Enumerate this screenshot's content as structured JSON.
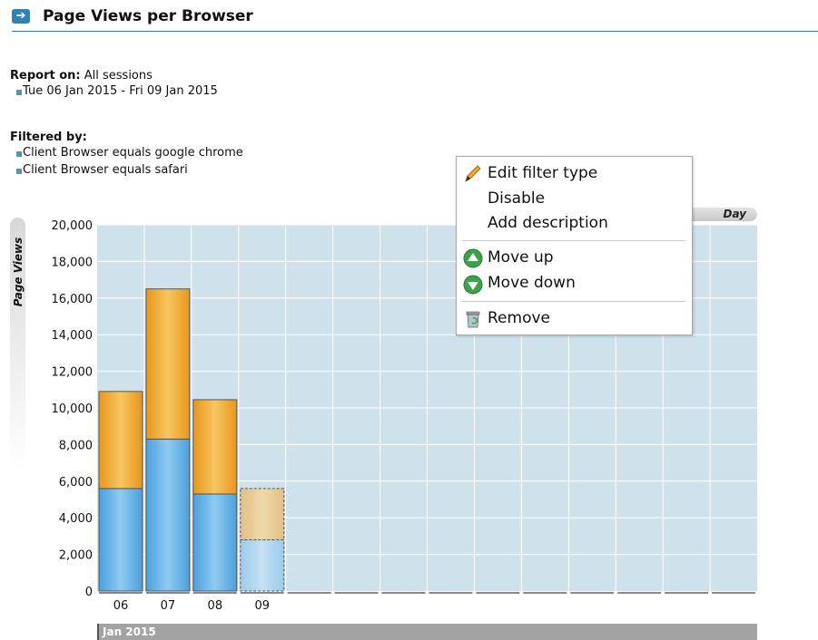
{
  "report": {
    "title": "Page Views per Browser",
    "report_on_label": "Report on:",
    "report_on_value": "All sessions",
    "date_range": "Tue 06 Jan 2015 - Fri 09 Jan 2015",
    "filtered_by_label": "Filtered by:",
    "filters": [
      "Client Browser equals google chrome",
      "Client Browser equals safari"
    ]
  },
  "context_menu": {
    "edit_filter_type": "Edit filter type",
    "disable": "Disable",
    "add_description": "Add description",
    "move_up": "Move up",
    "move_down": "Move down",
    "remove": "Remove"
  },
  "colors": {
    "series_blue": "#6fb6e6",
    "series_orange": "#f0a830",
    "plot_bg": "#cfe2ec",
    "accent": "#2f82b1"
  },
  "chart_data": {
    "type": "bar",
    "stacked": true,
    "ylabel": "Page Views",
    "period_label": "Day",
    "month_label": "Jan 2015",
    "categories": [
      "06",
      "07",
      "08",
      "09"
    ],
    "x_slots": 14,
    "ylim": [
      0,
      20000
    ],
    "yticks": [
      0,
      2000,
      4000,
      6000,
      8000,
      10000,
      12000,
      14000,
      16000,
      18000,
      20000
    ],
    "ytick_labels": [
      "0",
      "2,000",
      "4,000",
      "6,000",
      "8,000",
      "10,000",
      "12,000",
      "14,000",
      "16,000",
      "18,000",
      "20,000"
    ],
    "series": [
      {
        "values": [
          5600,
          8300,
          5300,
          2800
        ]
      },
      {
        "values": [
          5300,
          8200,
          5150,
          2800
        ]
      }
    ],
    "partial_categories": [
      "09"
    ],
    "grid": true
  }
}
